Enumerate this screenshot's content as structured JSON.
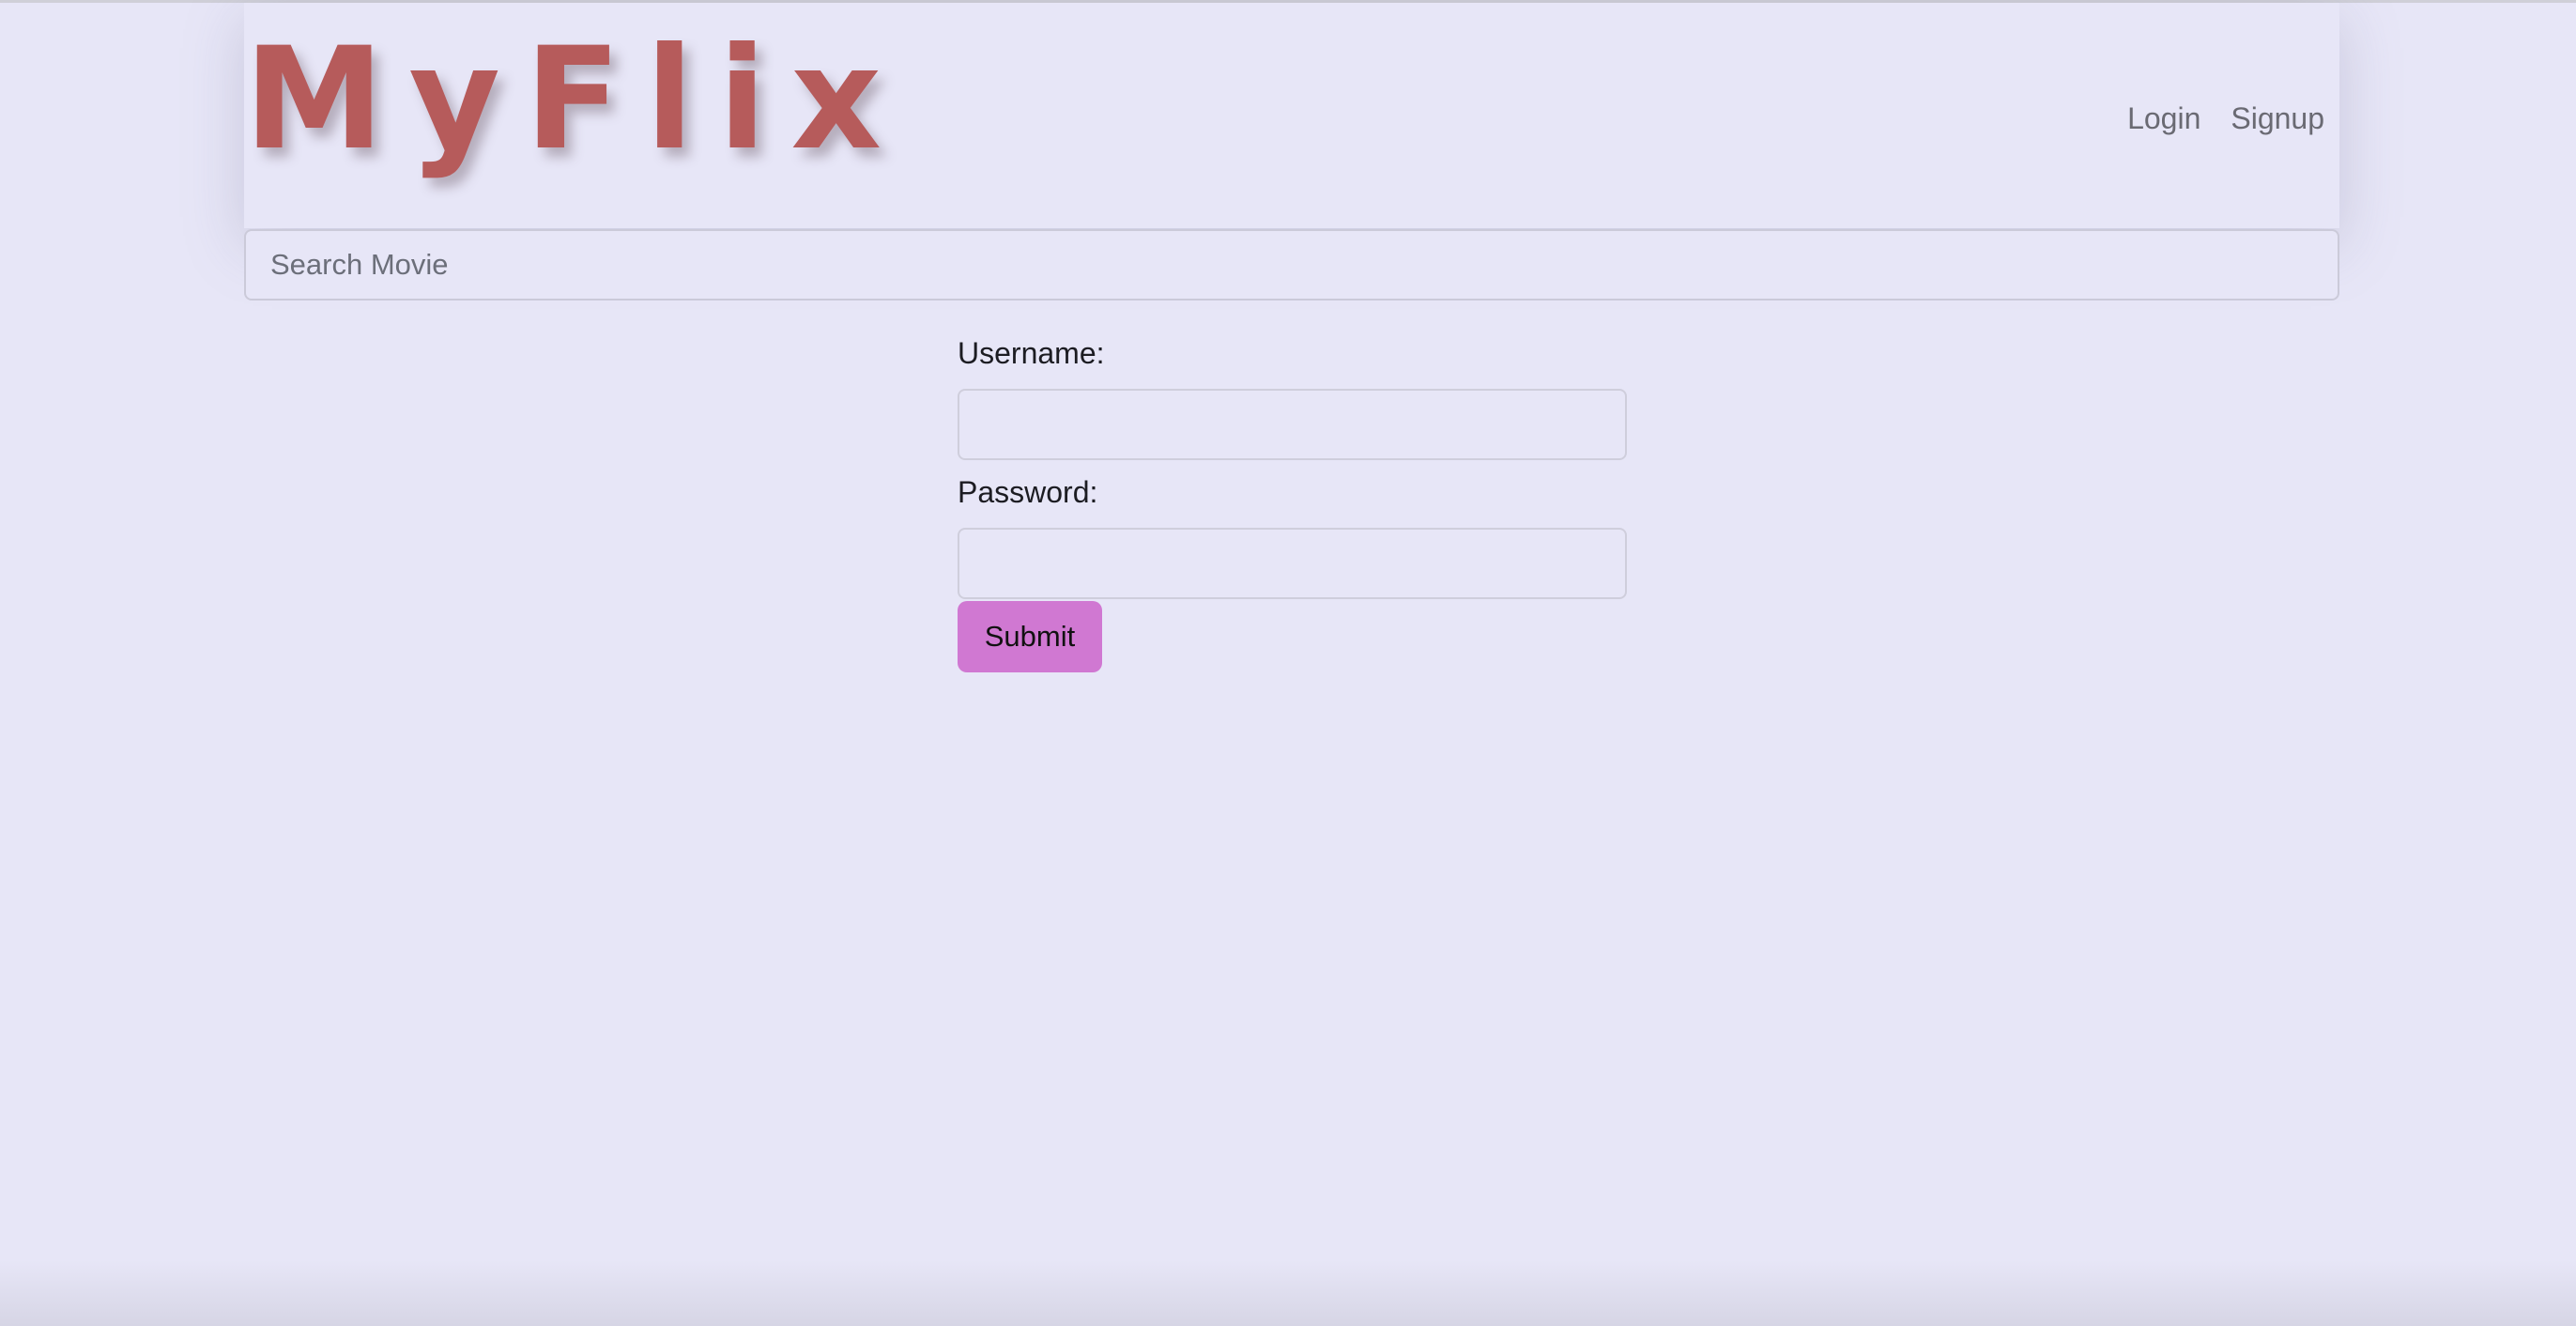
{
  "app": {
    "logo_text": "MyFlix"
  },
  "nav": {
    "items": [
      {
        "label": "Login"
      },
      {
        "label": "Signup"
      }
    ]
  },
  "search": {
    "placeholder": "Search Movie",
    "value": ""
  },
  "login_form": {
    "username_label": "Username:",
    "username_value": "",
    "password_label": "Password:",
    "password_value": "",
    "submit_label": "Submit"
  },
  "colors": {
    "background": "#e7e6f7",
    "logo": "#b65b5b",
    "submit_button": "#d078d2",
    "nav_text": "#6a6a73"
  }
}
